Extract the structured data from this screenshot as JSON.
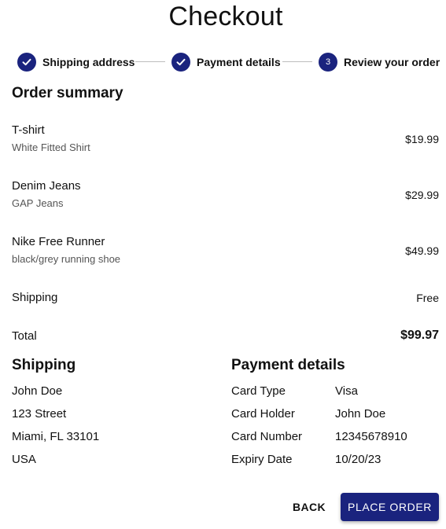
{
  "page": {
    "title": "Checkout"
  },
  "stepper": {
    "steps": [
      {
        "label": "Shipping address",
        "state": "completed",
        "icon": "check-icon"
      },
      {
        "label": "Payment details",
        "state": "completed",
        "icon": "check-icon"
      },
      {
        "label": "Review your order",
        "state": "active",
        "number": "3"
      }
    ]
  },
  "order_summary": {
    "heading": "Order summary",
    "items": [
      {
        "name": "T-shirt",
        "desc": "White Fitted Shirt",
        "price": "$19.99"
      },
      {
        "name": "Denim Jeans",
        "desc": "GAP Jeans",
        "price": "$29.99"
      },
      {
        "name": "Nike Free Runner",
        "desc": "black/grey running shoe",
        "price": "$49.99"
      }
    ],
    "shipping_label": "Shipping",
    "shipping_value": "Free",
    "total_label": "Total",
    "total_value": "$99.97"
  },
  "shipping": {
    "heading": "Shipping",
    "name": "John Doe",
    "street": "123 Street",
    "city": "Miami, FL 33101",
    "country": "USA"
  },
  "payment": {
    "heading": "Payment details",
    "rows": [
      {
        "label": "Card Type",
        "value": "Visa"
      },
      {
        "label": "Card Holder",
        "value": "John Doe"
      },
      {
        "label": "Card Number",
        "value": "12345678910"
      },
      {
        "label": "Expiry Date",
        "value": "10/20/23"
      }
    ]
  },
  "actions": {
    "back_label": "BACK",
    "place_order_label": "PLACE ORDER"
  },
  "colors": {
    "primary": "#1a237e",
    "connector": "#bdbdbd",
    "secondary_text": "#555555"
  }
}
